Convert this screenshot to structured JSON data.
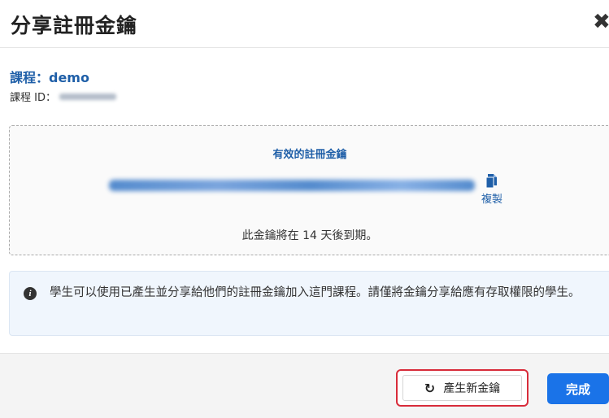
{
  "dialog": {
    "title": "分享註冊金鑰",
    "close_symbol": "✖"
  },
  "course": {
    "name": "課程：demo",
    "id_label": "課程 ID："
  },
  "enrollment_key": {
    "heading": "有效的註冊金鑰",
    "copy_label": "複製",
    "expiry_text": "此金鑰將在 14 天後到期。"
  },
  "info": {
    "icon": "info-circle-icon",
    "text": "學生可以使用已產生並分享給他們的註冊金鑰加入這門課程。請僅將金鑰分享給應有存取權限的學生。"
  },
  "footer": {
    "regenerate_icon": "↻",
    "regenerate_label": "產生新金鑰",
    "done_label": "完成"
  },
  "colors": {
    "accent": "#1a73e8",
    "link": "#1f5fa8",
    "highlight_border": "#d82c3a",
    "info_bg": "#f0f6fd"
  }
}
